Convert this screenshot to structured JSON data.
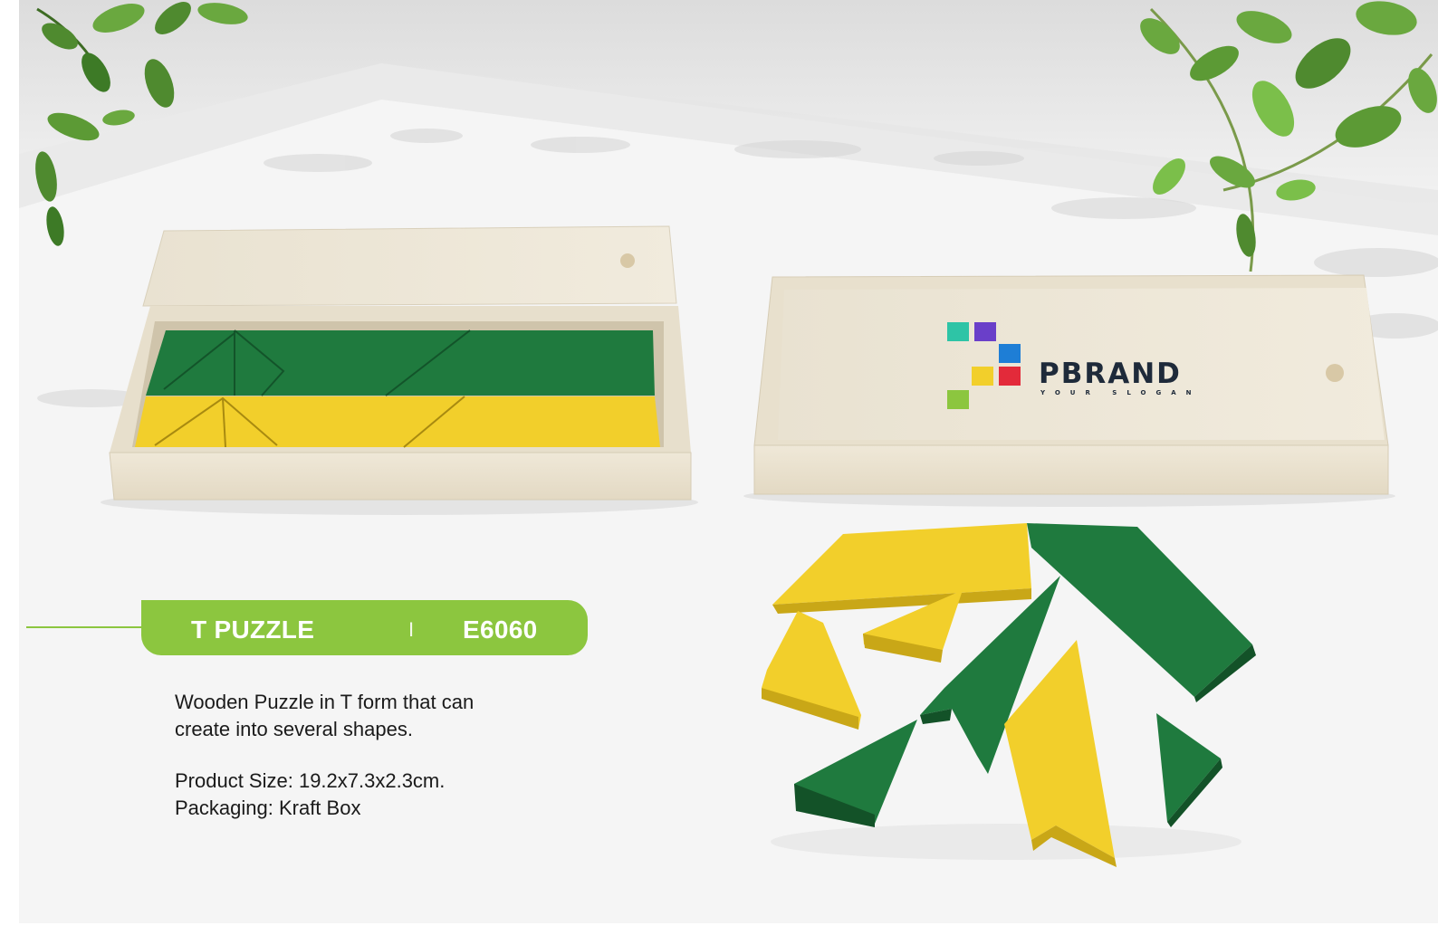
{
  "product": {
    "name": "T PUZZLE",
    "separator": "I",
    "code": "E6060",
    "description_lines": [
      "Wooden Puzzle in T form that can",
      "create into several shapes."
    ],
    "spec_lines": [
      "Product Size: 19.2x7.3x2.3cm.",
      "Packaging: Kraft Box"
    ]
  },
  "box_logo": {
    "brand": "PBRAND",
    "slogan": "YOUR SLOGAN"
  },
  "colors": {
    "accent": "#8cc63f",
    "puzzle_green": "#1f7a3e",
    "puzzle_yellow": "#f2cf2b",
    "wood": "#ece4d2"
  }
}
